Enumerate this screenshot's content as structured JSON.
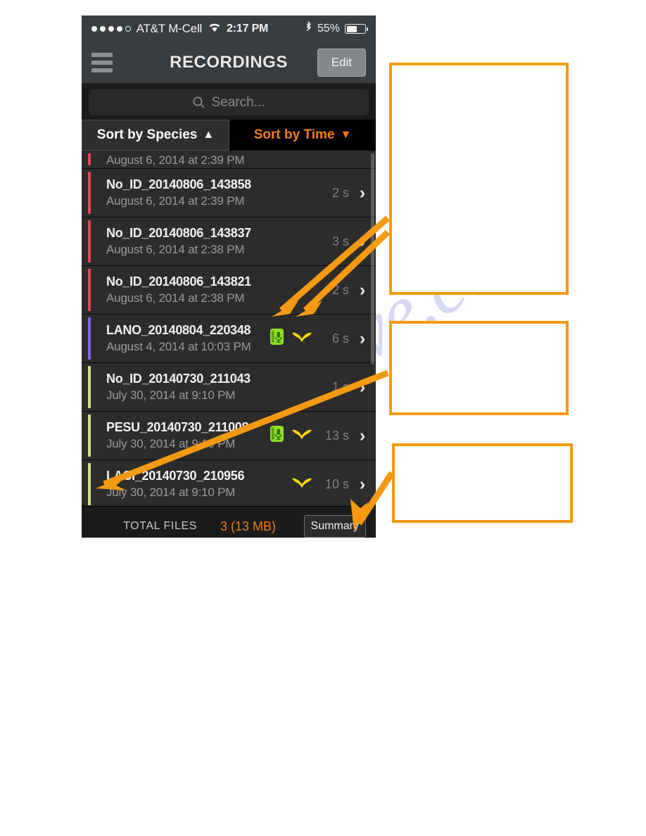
{
  "watermark": {
    "text": "manualshive.com"
  },
  "statusbar": {
    "carrier": "AT&T M-Cell",
    "time": "2:17 PM",
    "battery_percent": "55%",
    "signal_dots_filled": 4,
    "signal_dots_total": 5,
    "wifi_icon": "wifi-icon",
    "bluetooth_icon": "bluetooth-icon",
    "battery_icon": "battery-icon"
  },
  "navbar": {
    "menu_icon": "hamburger-menu-icon",
    "title": "RECORDINGS",
    "edit_label": "Edit"
  },
  "search": {
    "placeholder": "Search...",
    "icon": "search-icon"
  },
  "sort": {
    "species_label": "Sort by Species",
    "species_arrow": "▲",
    "time_label": "Sort by Time",
    "time_arrow": "▼"
  },
  "colors": {
    "accent_orange": "#f07d18",
    "callout_orange": "#f59a10",
    "edge_red": "#e04a52",
    "edge_purple": "#8b63e8",
    "edge_green": "#d5dd8c",
    "bat_yellow": "#ffd900",
    "mic_green": "#8fe023"
  },
  "list": {
    "partial_row": {
      "date": "August 6, 2014 at 2:39 PM",
      "edge_color": "#e04a52"
    },
    "rows": [
      {
        "name": "No_ID_20140806_143858",
        "date": "August 6, 2014 at 2:39 PM",
        "duration": "2 s",
        "edge_color": "#e04a52",
        "has_mic": false,
        "has_bat": false
      },
      {
        "name": "No_ID_20140806_143837",
        "date": "August 6, 2014 at 2:38 PM",
        "duration": "3 s",
        "edge_color": "#e04a52",
        "has_mic": false,
        "has_bat": false
      },
      {
        "name": "No_ID_20140806_143821",
        "date": "August 6, 2014 at 2:38 PM",
        "duration": "2 s",
        "edge_color": "#e04a52",
        "has_mic": false,
        "has_bat": false
      },
      {
        "name": "LANO_20140804_220348",
        "date": "August 4, 2014 at 10:03 PM",
        "duration": "6 s",
        "edge_color": "#8b63e8",
        "has_mic": true,
        "has_bat": true
      },
      {
        "name": "No_ID_20140730_211043",
        "date": "July 30, 2014 at 9:10 PM",
        "duration": "1 s",
        "edge_color": "#d5dd8c",
        "has_mic": false,
        "has_bat": false
      },
      {
        "name": "PESU_20140730_211008",
        "date": "July 30, 2014 at 9:10 PM",
        "duration": "13 s",
        "edge_color": "#d5dd8c",
        "has_mic": true,
        "has_bat": true
      },
      {
        "name": "LACI_20140730_210956",
        "date": "July 30, 2014 at 9:10 PM",
        "duration": "10 s",
        "edge_color": "#d5dd8c",
        "has_mic": false,
        "has_bat": true
      }
    ],
    "chevron": "›"
  },
  "footer": {
    "total_label": "TOTAL FILES",
    "total_value": "3 (13 MB)",
    "summary_label": "Summary"
  },
  "callouts": [
    {
      "id": "callout-1",
      "text": ""
    },
    {
      "id": "callout-2",
      "text": ""
    },
    {
      "id": "callout-3",
      "text": ""
    }
  ]
}
